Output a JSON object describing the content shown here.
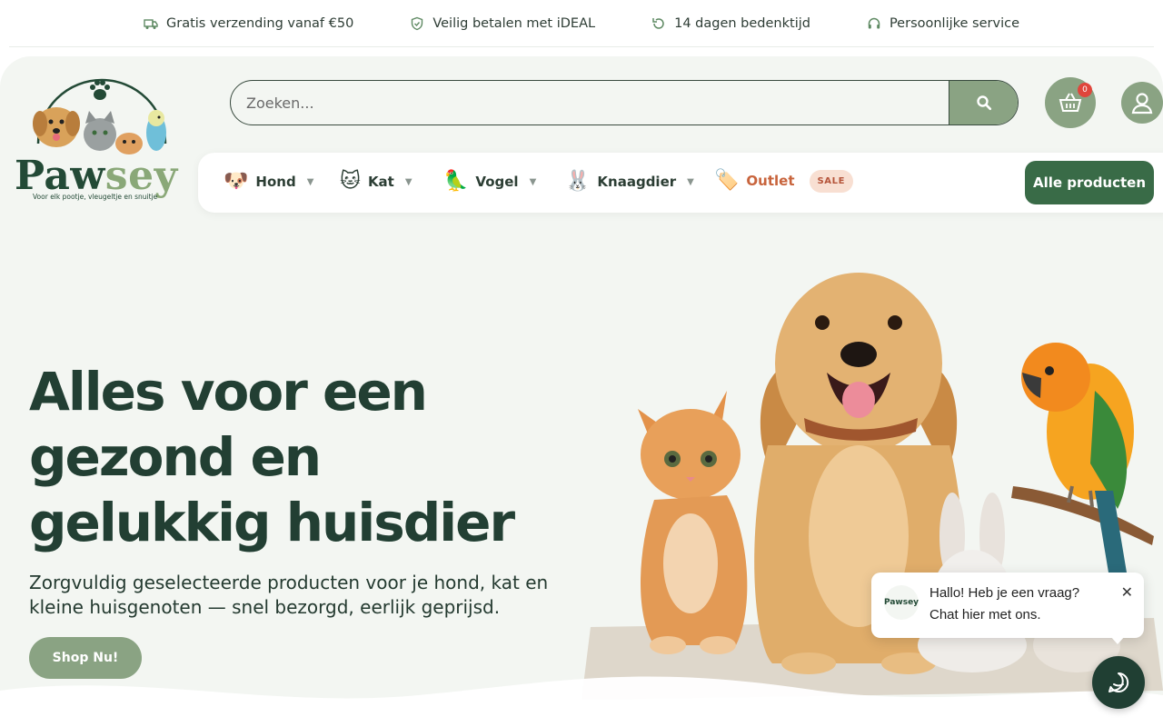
{
  "usp_bar": [
    {
      "icon": "truck-icon",
      "text": "Gratis verzending vanaf €50"
    },
    {
      "icon": "shield-check-icon",
      "text": "Veilig betalen met iDEAL"
    },
    {
      "icon": "return-arrow-icon",
      "text": "14 dagen bedenktijd"
    },
    {
      "icon": "headset-icon",
      "text": "Persoonlijke service"
    }
  ],
  "logo": {
    "word_1": "Paw",
    "word_2": "sey",
    "tagline": "Voor elk pootje, vleugeltje en snuitje"
  },
  "search": {
    "placeholder": "Zoeken..."
  },
  "cart": {
    "count": "0"
  },
  "nav": {
    "items": [
      {
        "label": "Hond",
        "icon": "dog-icon"
      },
      {
        "label": "Kat",
        "icon": "cat-icon"
      },
      {
        "label": "Vogel",
        "icon": "bird-icon"
      },
      {
        "label": "Knaagdier",
        "icon": "rabbit-icon"
      },
      {
        "label": "Outlet",
        "icon": "tag-icon",
        "badge": "SALE"
      }
    ],
    "all_products": "Alle producten"
  },
  "hero": {
    "title_line_1": "Alles voor een",
    "title_line_2": "gezond en",
    "title_line_3": "gelukkig huisdier",
    "subtitle_line_1": "Zorgvuldig geselecteerde producten voor je hond, kat en",
    "subtitle_line_2": "kleine huisgenoten — snel bezorgd, eerlijk geprijsd.",
    "cta": "Shop Nu!"
  },
  "chat": {
    "avatar_text": "Pawsey",
    "line_1": "Hallo! Heb je een vraag?",
    "line_2": "Chat hier met ons."
  },
  "colors": {
    "brand_dark": "#396b47",
    "brand_sage": "#8aa383",
    "text_dark": "#223f33",
    "sale": "#c8643c"
  }
}
